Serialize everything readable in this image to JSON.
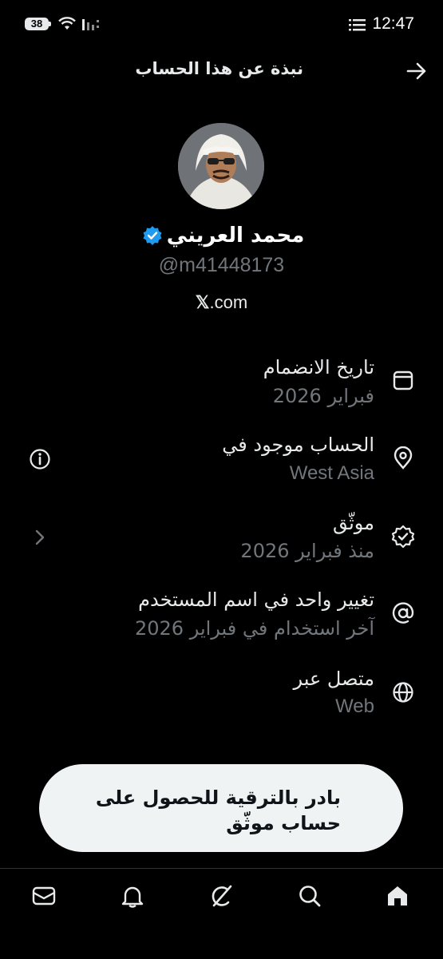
{
  "status_bar": {
    "battery": "38",
    "time": "12:47"
  },
  "header": {
    "title": "نبذة عن هذا الحساب"
  },
  "profile": {
    "display_name": "محمد العريني",
    "handle": "@m41448173",
    "site_suffix": ".com",
    "site_logo": "𝕏"
  },
  "info_rows": [
    {
      "title": "تاريخ الانضمام",
      "subtitle": "فبراير 2026",
      "icon": "calendar-icon"
    },
    {
      "title": "الحساب موجود في",
      "subtitle": "West Asia",
      "icon": "location-pin-icon"
    },
    {
      "title": "موثّق",
      "subtitle": "منذ فبراير 2026",
      "icon": "verified-check-icon"
    },
    {
      "title": "تغيير واحد في اسم المستخدم",
      "subtitle": "آخر استخدام في فبراير 2026",
      "icon": "at-sign-icon"
    },
    {
      "title": "متصل عبر",
      "subtitle": "Web",
      "icon": "globe-icon"
    }
  ],
  "cta": {
    "label_line1": "بادر بالترقية للحصول على",
    "label_line2": "حساب موثّق"
  },
  "bottom_nav": [
    "mail-icon",
    "bell-icon",
    "grok-icon",
    "search-icon",
    "home-icon"
  ],
  "colors": {
    "background": "#000000",
    "text": "#e7e9ea",
    "muted": "#71767b",
    "verified_blue": "#1d9bf0",
    "cta_background": "#eff3f4"
  }
}
